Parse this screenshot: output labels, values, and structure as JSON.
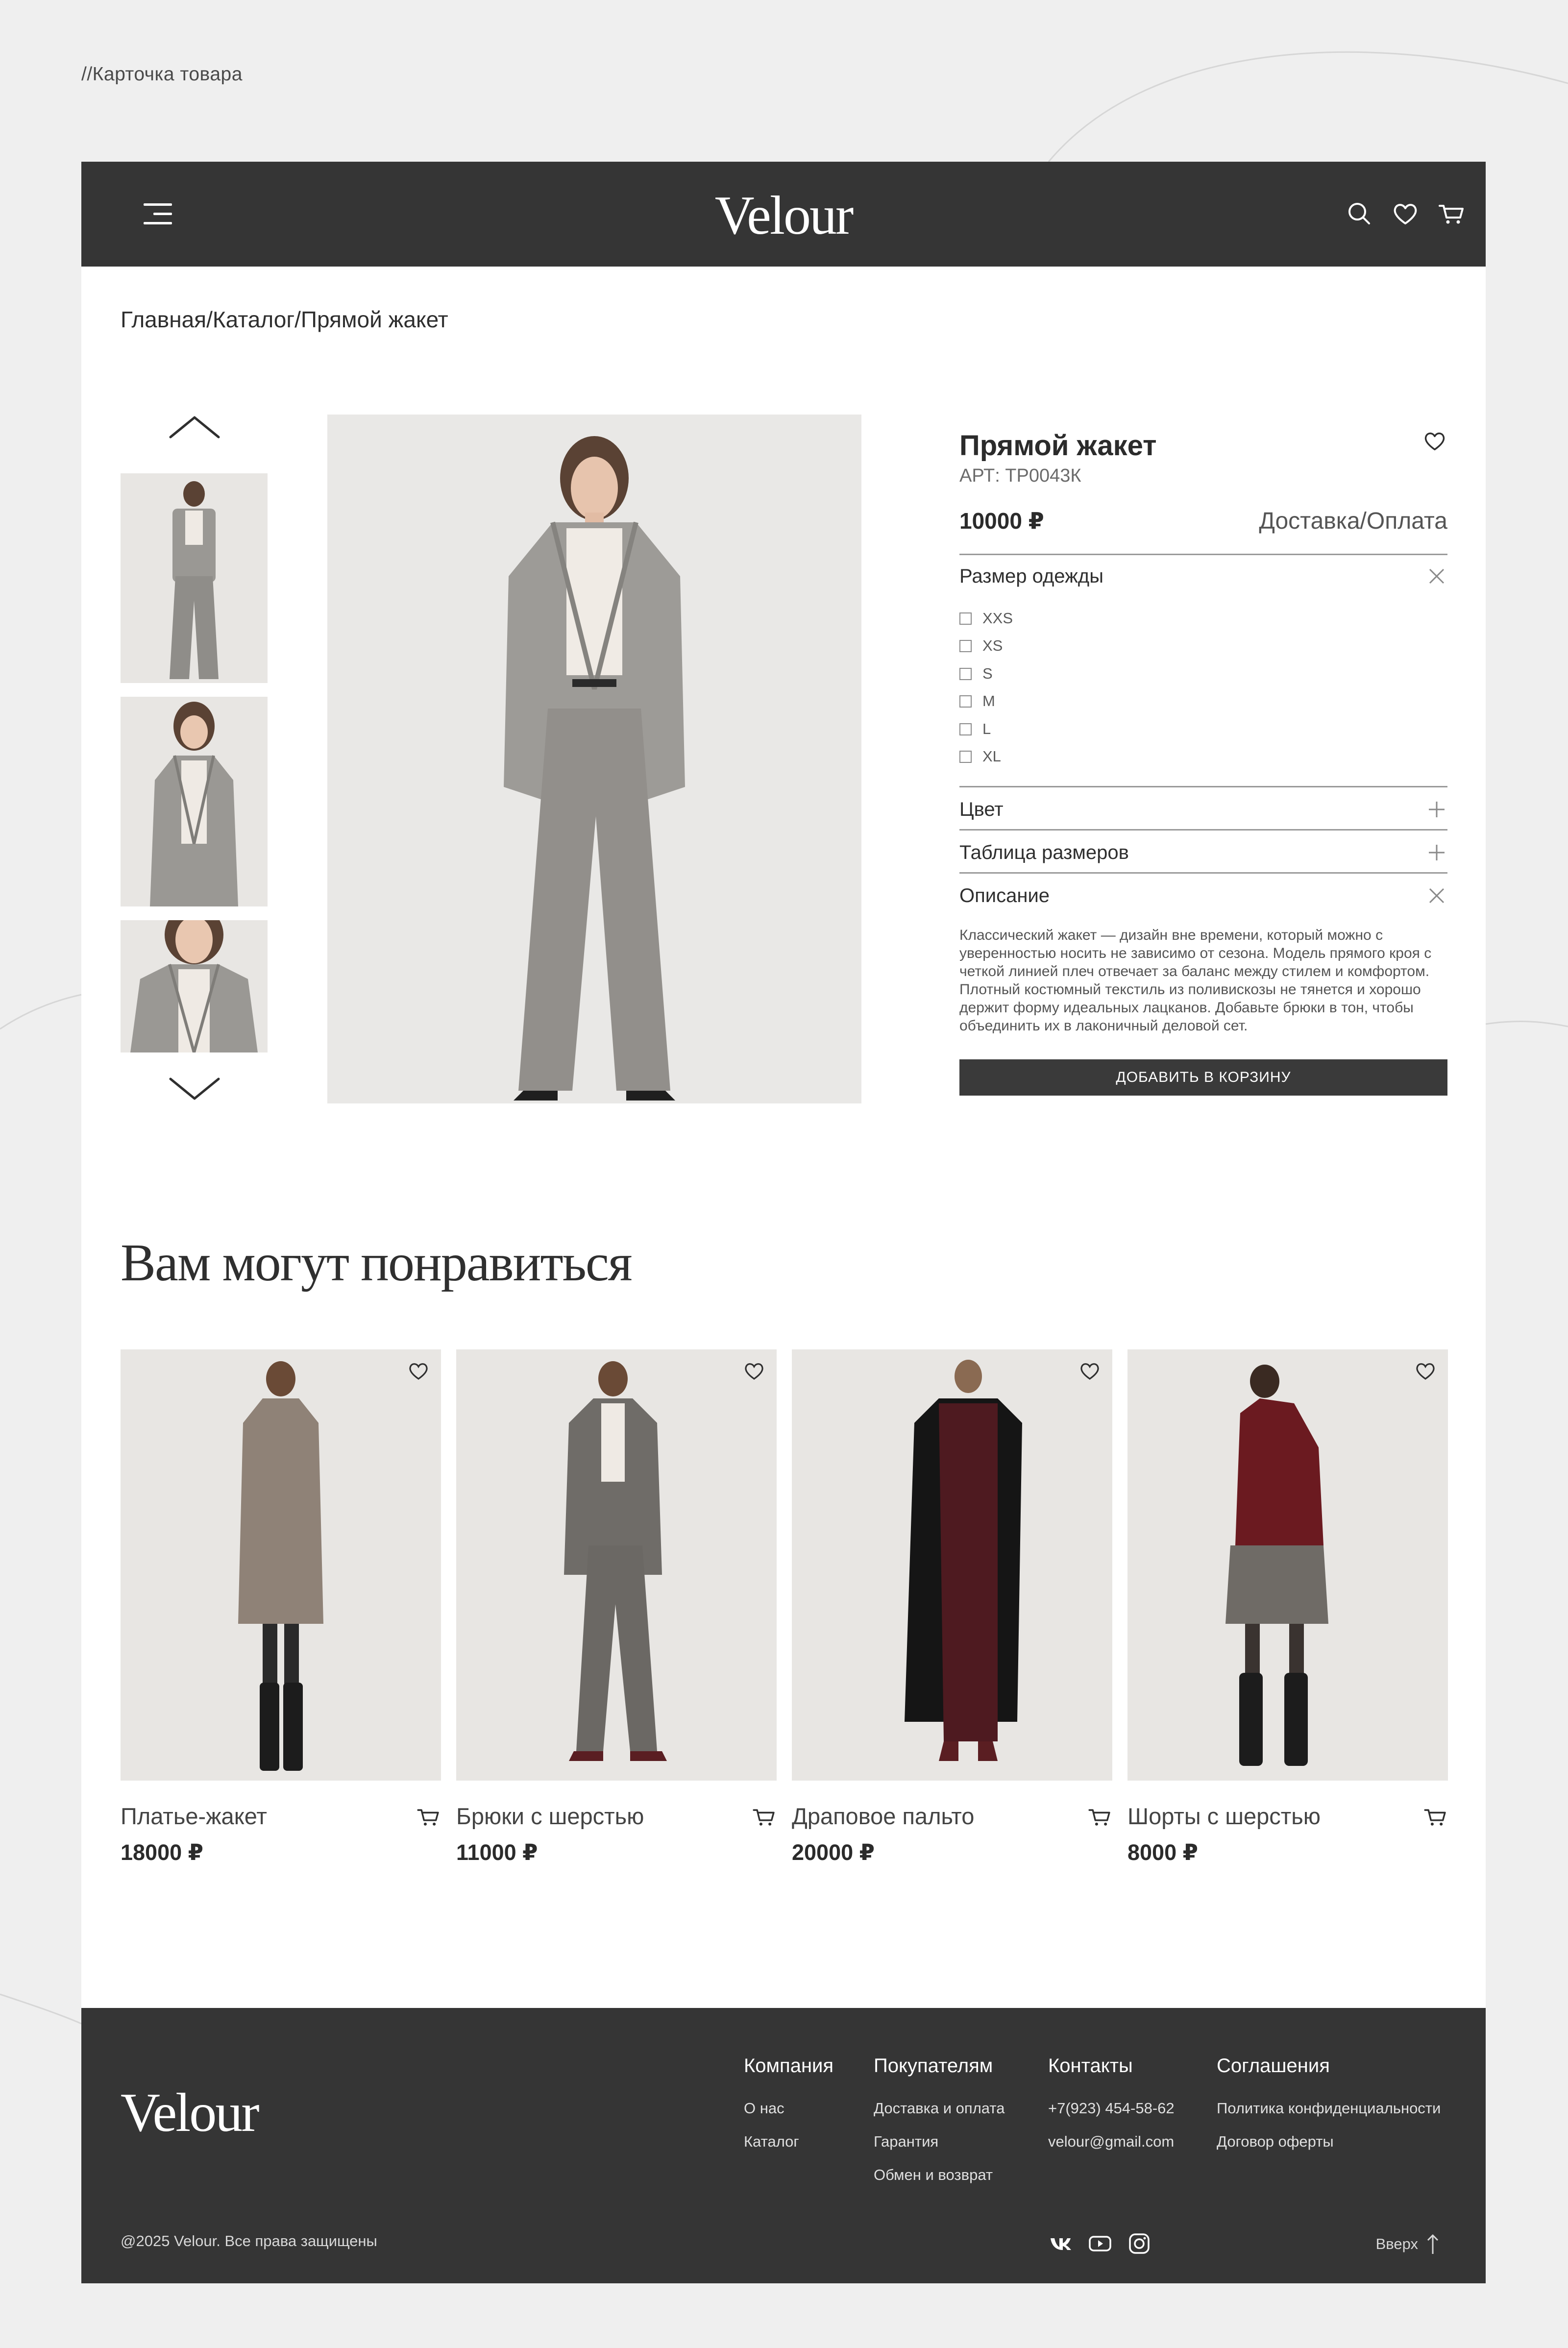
{
  "caption": "//Карточка товара",
  "brand": "Velour",
  "breadcrumb": {
    "home": "Главная",
    "sep1": "/",
    "catalog": "Каталог",
    "sep2": "/",
    "current": "Прямой жакет"
  },
  "product": {
    "title": "Прямой жакет",
    "article": "АРТ: ТР0043К",
    "price": "10000 ₽",
    "delivery_link": "Доставка/Оплата",
    "size_section": "Размер одежды",
    "sizes": [
      "XXS",
      "XS",
      "S",
      "M",
      "L",
      "XL"
    ],
    "color_section": "Цвет",
    "size_table_section": "Таблица размеров",
    "description_section": "Описание",
    "description": "Классический жакет — дизайн вне времени, который можно с уверенностью носить не зависимо от сезона. Модель прямого кроя с четкой линией плеч отвечает за баланс между стилем и комфортом. Плотный костюмный текстиль из поливискозы не тянется и хорошо держит форму идеальных лацканов. Добавьте брюки в тон, чтобы объединить их в лаконичный деловой сет.",
    "add_to_cart": "ДОБАВИТЬ В КОРЗИНУ"
  },
  "recommendations": {
    "title": "Вам могут понравиться",
    "items": [
      {
        "name": "Платье-жакет",
        "price": "18000 ₽"
      },
      {
        "name": "Брюки с шерстью",
        "price": "11000 ₽"
      },
      {
        "name": "Драповое пальто",
        "price": "20000 ₽"
      },
      {
        "name": "Шорты с шерстью",
        "price": "8000 ₽"
      }
    ]
  },
  "footer": {
    "columns": [
      {
        "title": "Компания",
        "links": [
          "О нас",
          "Каталог"
        ]
      },
      {
        "title": "Покупателям",
        "links": [
          "Доставка и оплата",
          "Гарантия",
          "Обмен и возврат"
        ]
      },
      {
        "title": "Контакты",
        "links": [
          "+7(923) 454-58-62",
          "velour@gmail.com"
        ]
      },
      {
        "title": "Соглашения",
        "links": [
          "Политика конфиденциальности",
          "Договор оферты"
        ]
      }
    ],
    "copyright": "@2025 Velour. Все права защищены",
    "to_top": "Вверх"
  },
  "icons": [
    "menu-icon",
    "search-icon",
    "heart-icon",
    "cart-icon",
    "chevron-up-icon",
    "chevron-down-icon",
    "close-icon",
    "plus-icon",
    "vk-icon",
    "youtube-icon",
    "instagram-icon",
    "arrow-up-icon"
  ],
  "colors": {
    "header": "#353535",
    "background": "#efefef",
    "card": "#ffffff",
    "button": "#3a3a3a"
  }
}
